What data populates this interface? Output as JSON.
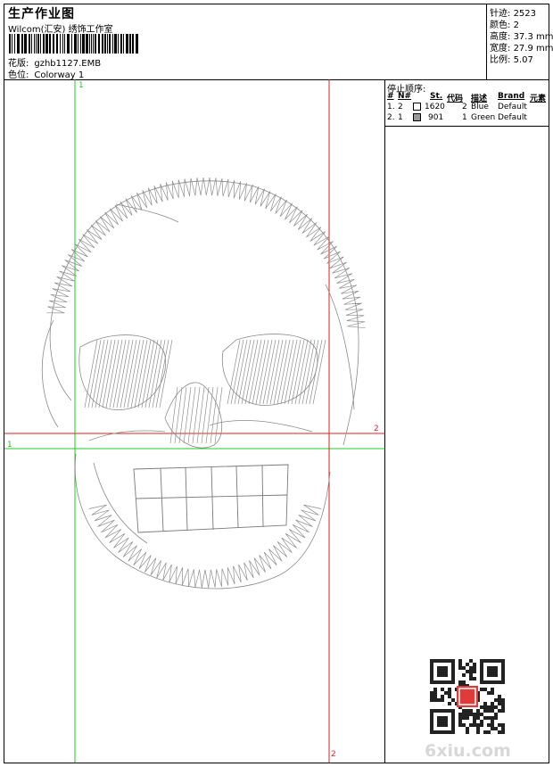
{
  "header": {
    "title": "生产作业图",
    "subtitle": "Wilcom(汇安) 绣饰工作室",
    "design_label": "花版:",
    "design_value": "gzhb1127.EMB",
    "colorway_label": "色位:",
    "colorway_value": "Colorway 1"
  },
  "stats": {
    "stitches_label": "针迹:",
    "stitches_value": "2523",
    "colors_label": "颜色:",
    "colors_value": "2",
    "height_label": "高度:",
    "height_value": "37.3 mm",
    "width_label": "宽度:",
    "width_value": "27.9 mm",
    "ratio_label": "比例:",
    "ratio_value": "5.07"
  },
  "stop_sequence": {
    "title": "停止顺序:",
    "columns": [
      "#",
      "N#",
      "St.",
      "代码",
      "描述",
      "Brand",
      "元素"
    ],
    "rows": [
      {
        "num": "1.",
        "needle": "2",
        "stitches": "1620",
        "code": "2",
        "desc": "Blue",
        "brand": "Default",
        "swatch": "#ffffff"
      },
      {
        "num": "2.",
        "needle": "1",
        "stitches": "901",
        "code": "1",
        "desc": "Green",
        "brand": "Default",
        "swatch": "#9a9a9a"
      }
    ]
  },
  "guides": {
    "green_label_top": "1",
    "green_label_left": "1",
    "red_label_right": "2",
    "red_label_bottom": "2",
    "green_color": "#22cc22",
    "red_color": "#dd2222"
  },
  "watermark": "6xiu.com"
}
